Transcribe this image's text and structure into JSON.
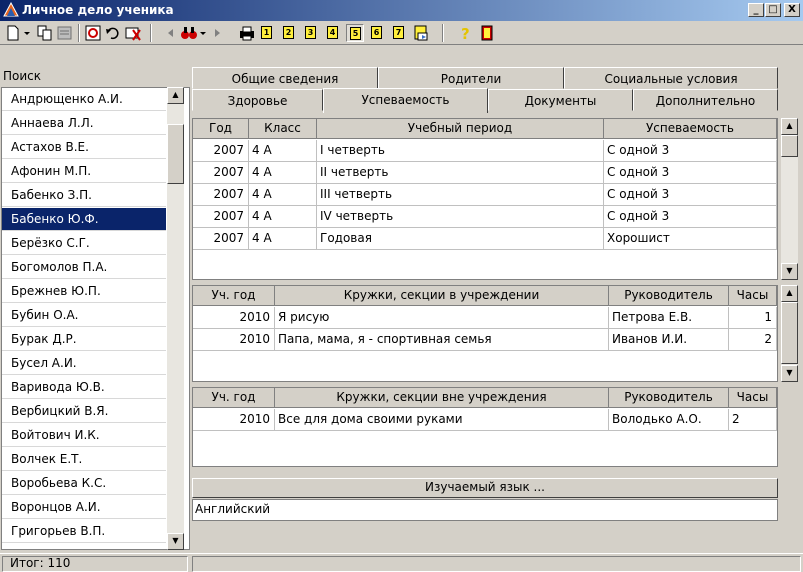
{
  "window": {
    "title": "Личное дело ученика",
    "caption_buttons": [
      "_",
      "□",
      "X"
    ]
  },
  "toolbar": {
    "icons": [
      "new-document-icon",
      "dropdown-arrow-icon",
      "copy-icon",
      "properties-icon",
      "refresh-icon",
      "undo-icon",
      "delete-icon",
      "prev-icon",
      "binoculars-icon",
      "next-icon",
      "print-icon",
      "page-1-icon",
      "page-2-icon",
      "page-3-icon",
      "page-4-icon",
      "page-5-icon",
      "page-6-icon",
      "page-7-icon",
      "report-icon",
      "help-icon",
      "exit-icon"
    ],
    "page_numbers": [
      "1",
      "2",
      "3",
      "4",
      "5",
      "6",
      "7"
    ],
    "help_glyph": "?"
  },
  "sidebar": {
    "search_label": "Поиск",
    "items": [
      "Андрющенко А.И.",
      "Аннаева Л.Л.",
      "Астахов В.Е.",
      "Афонин М.П.",
      "Бабенко З.П.",
      "Бабенко Ю.Ф.",
      "Берёзко С.Г.",
      "Богомолов П.А.",
      "Брежнев Ю.П.",
      "Бубин О.А.",
      "Бурак Д.Р.",
      "Бусел А.И.",
      "Варивода Ю.В.",
      "Вербицкий В.Я.",
      "Войтович И.К.",
      "Волчек Е.Т.",
      "Воробьева К.С.",
      "Воронцов А.И.",
      "Григорьев В.П."
    ],
    "selected_index": 5
  },
  "status": {
    "total": "Итог:  110"
  },
  "tabs": {
    "row1": [
      "Общие сведения",
      "Родители",
      "Социальные условия"
    ],
    "row2": [
      "Здоровье",
      "Успеваемость",
      "Документы",
      "Дополнительно"
    ],
    "active": "Успеваемость"
  },
  "performance_table": {
    "headers": [
      "Год",
      "Класс",
      "Учебный период",
      "Успеваемость"
    ],
    "rows": [
      [
        "2007",
        "4 А",
        "I четверть",
        "С одной 3"
      ],
      [
        "2007",
        "4 А",
        "II четверть",
        "С одной 3"
      ],
      [
        "2007",
        "4 А",
        "III четверть",
        "С одной 3"
      ],
      [
        "2007",
        "4 А",
        "IV четверть",
        "С одной 3"
      ],
      [
        "2007",
        "4 А",
        "Годовая",
        "Хорошист"
      ]
    ]
  },
  "clubs_inside_table": {
    "headers": [
      "Уч. год",
      "Кружки, секции в учреждении",
      "Руководитель",
      "Часы"
    ],
    "rows": [
      [
        "2010",
        "Я рисую",
        "Петрова Е.В.",
        "1"
      ],
      [
        "2010",
        "Папа, мама, я - спортивная семья",
        "Иванов И.И.",
        "2"
      ]
    ]
  },
  "clubs_outside_table": {
    "headers": [
      "Уч. год",
      "Кружки, секции вне учреждения",
      "Руководитель",
      "Часы"
    ],
    "rows": [
      [
        "2010",
        "Все для дома своими руками",
        "Володько А.О.",
        "2"
      ]
    ]
  },
  "language": {
    "header": "Изучаемый язык ...",
    "value": "Английский"
  },
  "colors": {
    "titlebar_start": "#0a246a",
    "titlebar_end": "#a6caf0",
    "selection": "#0a246a",
    "face": "#d4d0c8"
  }
}
